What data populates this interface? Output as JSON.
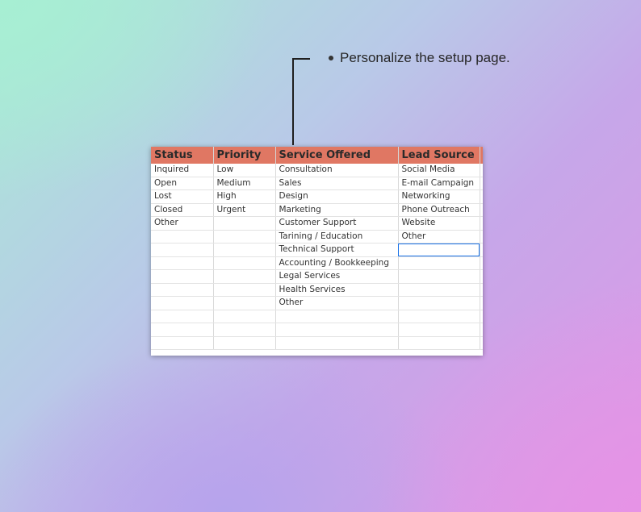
{
  "callout": {
    "text": "Personalize the setup page."
  },
  "sheet": {
    "headers": [
      "Status",
      "Priority",
      "Service Offered",
      "Lead Source"
    ],
    "rows": [
      [
        "Inquired",
        "Low",
        "Consultation",
        "Social Media"
      ],
      [
        "Open",
        "Medium",
        "Sales",
        "E-mail Campaign"
      ],
      [
        "Lost",
        "High",
        "Design",
        "Networking"
      ],
      [
        "Closed",
        "Urgent",
        "Marketing",
        "Phone Outreach"
      ],
      [
        "Other",
        "",
        "Customer Support",
        "Website"
      ],
      [
        "",
        "",
        "Tarining / Education",
        "Other"
      ],
      [
        "",
        "",
        "Technical Support",
        ""
      ],
      [
        "",
        "",
        "Accounting / Bookkeeping",
        ""
      ],
      [
        "",
        "",
        "Legal Services",
        ""
      ],
      [
        "",
        "",
        "Health Services",
        ""
      ],
      [
        "",
        "",
        "Other",
        ""
      ],
      [
        "",
        "",
        "",
        ""
      ],
      [
        "",
        "",
        "",
        ""
      ],
      [
        "",
        "",
        "",
        ""
      ]
    ],
    "header_color": "#e07763",
    "selection_color": "#1a73e8"
  }
}
